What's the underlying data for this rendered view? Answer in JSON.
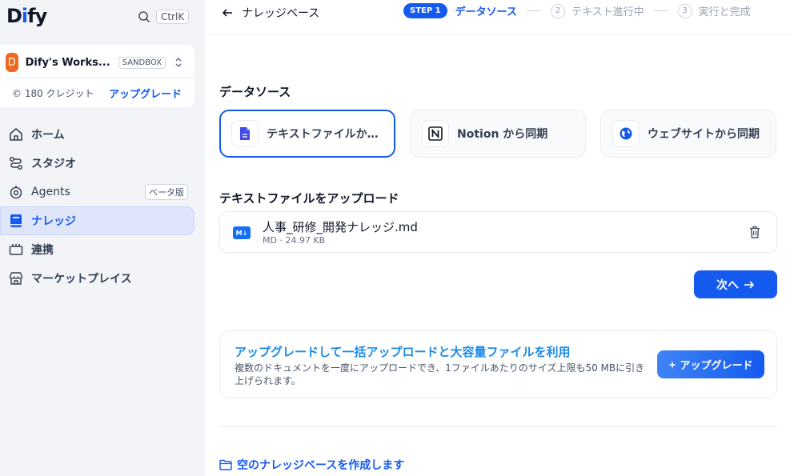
{
  "sidebar": {
    "logo_prefix": "D",
    "logo_accent": "i",
    "logo_suffix": "fy",
    "search_shortcut": "CtrlK",
    "workspace": {
      "avatar": "D",
      "name": "Dify's Works...",
      "badge": "SANDBOX",
      "credits": "© 180 クレジット",
      "upgrade_label": "アップグレード"
    },
    "nav": [
      {
        "label": "ホーム",
        "icon": "home-icon"
      },
      {
        "label": "スタジオ",
        "icon": "studio-icon"
      },
      {
        "label": "Agents",
        "icon": "agents-icon",
        "badge": "ベータ版"
      },
      {
        "label": "ナレッジ",
        "icon": "knowledge-icon",
        "active": true
      },
      {
        "label": "連携",
        "icon": "integration-icon"
      },
      {
        "label": "マーケットプレイス",
        "icon": "marketplace-icon"
      }
    ]
  },
  "header": {
    "back_label": "ナレッジベース",
    "steps": [
      {
        "pill": "STEP 1",
        "label": "データソース",
        "active": true
      },
      {
        "num": "2",
        "label": "テキスト進行中"
      },
      {
        "num": "3",
        "label": "実行と完成"
      }
    ]
  },
  "main": {
    "datasource_title": "データソース",
    "sources": [
      {
        "label": "テキストファイルからインポート",
        "icon": "file-icon",
        "active": true
      },
      {
        "label": "Notion から同期",
        "icon": "notion-icon"
      },
      {
        "label": "ウェブサイトから同期",
        "icon": "globe-icon"
      }
    ],
    "upload_title": "テキストファイルをアップロード",
    "file": {
      "type_icon": "M↓",
      "name": "人事_研修_開発ナレッジ.md",
      "meta": "MD · 24.97 KB"
    },
    "next_label": "次へ",
    "promo": {
      "title": "アップグレードして一括アップロードと大容量ファイルを利用",
      "desc": "複数のドキュメントを一度にアップロードでき、1ファイルあたりのサイズ上限も50 MBに引き上げられます。",
      "button_label": "アップグレード"
    },
    "empty_label": "空のナレッジベースを作成します"
  },
  "colors": {
    "accent": "#155aef",
    "promo_title": "#1b8be8",
    "workspace_avatar": "#ef6820"
  }
}
